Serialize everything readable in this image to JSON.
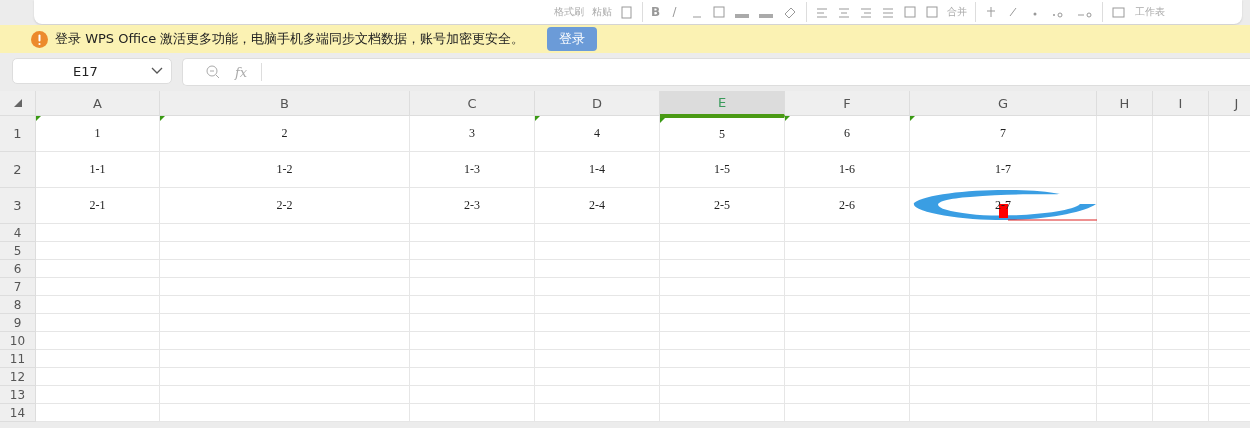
{
  "toolbar": {
    "labels": [
      "格式刷",
      "粘贴",
      "合并",
      "工作表"
    ],
    "bold": "B"
  },
  "banner": {
    "message": "登录 WPS Office 激活更多功能，电脑手机多端同步文档数据，账号加密更安全。",
    "button": "登录"
  },
  "formula_bar": {
    "cell_ref": "E17",
    "formula_icon": "fx"
  },
  "sheet": {
    "columns": [
      {
        "label": "A",
        "selected": false
      },
      {
        "label": "B",
        "selected": false
      },
      {
        "label": "C",
        "selected": false
      },
      {
        "label": "D",
        "selected": false
      },
      {
        "label": "E",
        "selected": true
      },
      {
        "label": "F",
        "selected": false
      },
      {
        "label": "G",
        "selected": false
      },
      {
        "label": "H",
        "selected": false
      },
      {
        "label": "I",
        "selected": false
      },
      {
        "label": "J",
        "selected": false
      }
    ],
    "rows": [
      {
        "label": "1",
        "cells": [
          {
            "text": "1",
            "flag": true
          },
          {
            "text": "2",
            "flag": true
          },
          {
            "text": "3",
            "flag": false
          },
          {
            "text": "4",
            "flag": true
          },
          {
            "text": "5",
            "flag": true
          },
          {
            "text": "6",
            "flag": true
          },
          {
            "text": "7",
            "flag": true
          }
        ]
      },
      {
        "label": "2",
        "cells": [
          {
            "text": "1-1",
            "flag": false
          },
          {
            "text": "1-2",
            "flag": false
          },
          {
            "text": "1-3",
            "flag": false
          },
          {
            "text": "1-4",
            "flag": false
          },
          {
            "text": "1-5",
            "flag": false
          },
          {
            "text": "1-6",
            "flag": false
          },
          {
            "text": "1-7",
            "flag": false
          }
        ]
      },
      {
        "label": "3",
        "cells": [
          {
            "text": "2-1",
            "flag": false
          },
          {
            "text": "2-2",
            "flag": false
          },
          {
            "text": "2-3",
            "flag": false
          },
          {
            "text": "2-4",
            "flag": false
          },
          {
            "text": "2-5",
            "flag": false
          },
          {
            "text": "2-6",
            "flag": false
          },
          {
            "text": "2-7",
            "flag": false
          }
        ]
      },
      {
        "label": "4",
        "cells": []
      },
      {
        "label": "5",
        "cells": []
      },
      {
        "label": "6",
        "cells": []
      },
      {
        "label": "7",
        "cells": []
      },
      {
        "label": "8",
        "cells": []
      },
      {
        "label": "9",
        "cells": []
      },
      {
        "label": "10",
        "cells": []
      },
      {
        "label": "11",
        "cells": []
      },
      {
        "label": "12",
        "cells": []
      },
      {
        "label": "13",
        "cells": []
      },
      {
        "label": "14",
        "cells": []
      }
    ]
  }
}
